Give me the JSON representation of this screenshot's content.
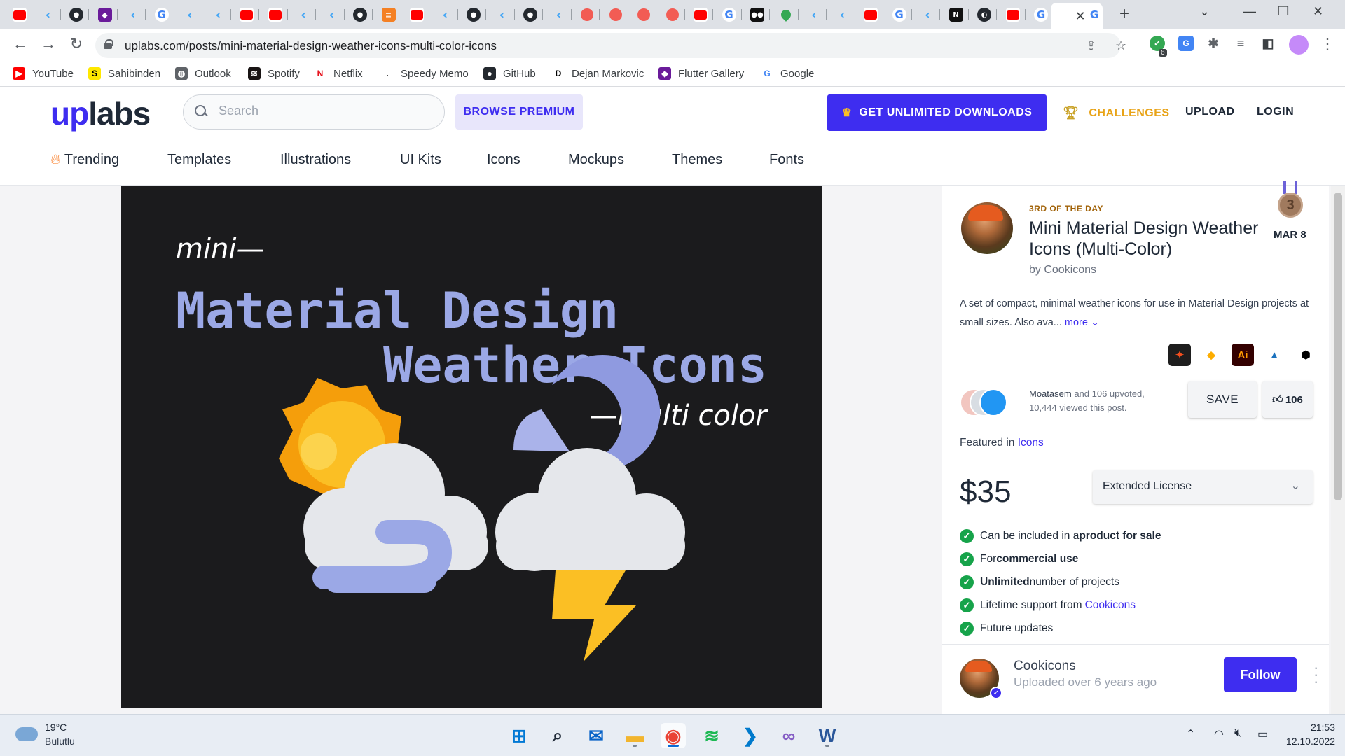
{
  "browser": {
    "tabs": [
      {
        "icon": "youtube-icon",
        "cls": "yt",
        "glyph": ""
      },
      {
        "icon": "flutter-icon",
        "cls": "flutter",
        "glyph": "‹"
      },
      {
        "icon": "github-icon",
        "cls": "gh",
        "glyph": "●"
      },
      {
        "icon": "visual-studio-icon",
        "cls": "purple",
        "glyph": "◆"
      },
      {
        "icon": "flutter-icon",
        "cls": "flutter",
        "glyph": "‹"
      },
      {
        "icon": "google-icon",
        "cls": "g",
        "glyph": "G"
      },
      {
        "icon": "flutter-icon",
        "cls": "flutter",
        "glyph": "‹"
      },
      {
        "icon": "flutter-icon",
        "cls": "flutter",
        "glyph": "‹"
      },
      {
        "icon": "youtube-icon",
        "cls": "yt",
        "glyph": ""
      },
      {
        "icon": "youtube-icon",
        "cls": "yt",
        "glyph": ""
      },
      {
        "icon": "flutter-icon",
        "cls": "flutter",
        "glyph": "‹"
      },
      {
        "icon": "flutter-icon",
        "cls": "flutter",
        "glyph": "‹"
      },
      {
        "icon": "github-icon",
        "cls": "gh",
        "glyph": "●"
      },
      {
        "icon": "stackoverflow-icon",
        "cls": "orange",
        "glyph": "≡"
      },
      {
        "icon": "youtube-icon",
        "cls": "yt",
        "glyph": ""
      },
      {
        "icon": "flutter-icon",
        "cls": "flutter",
        "glyph": "‹"
      },
      {
        "icon": "github-icon",
        "cls": "gh",
        "glyph": "●"
      },
      {
        "icon": "flutter-icon",
        "cls": "flutter",
        "glyph": "‹"
      },
      {
        "icon": "github-icon",
        "cls": "gh",
        "glyph": "●"
      },
      {
        "icon": "flutter-icon",
        "cls": "flutter",
        "glyph": "‹"
      },
      {
        "icon": "mushroom-icon",
        "cls": "red",
        "glyph": ""
      },
      {
        "icon": "mushroom-icon",
        "cls": "red",
        "glyph": ""
      },
      {
        "icon": "mushroom-icon",
        "cls": "red",
        "glyph": ""
      },
      {
        "icon": "mushroom-icon",
        "cls": "red",
        "glyph": ""
      },
      {
        "icon": "youtube-icon",
        "cls": "yt",
        "glyph": ""
      },
      {
        "icon": "google-icon",
        "cls": "g",
        "glyph": "G"
      },
      {
        "icon": "medium-icon",
        "cls": "dark",
        "glyph": "●●"
      },
      {
        "icon": "google-maps-icon",
        "cls": "maps",
        "glyph": ""
      },
      {
        "icon": "flutter-icon",
        "cls": "flutter",
        "glyph": "‹"
      },
      {
        "icon": "flutter-icon",
        "cls": "flutter",
        "glyph": "‹"
      },
      {
        "icon": "youtube-icon",
        "cls": "yt",
        "glyph": ""
      },
      {
        "icon": "google-icon",
        "cls": "g",
        "glyph": "G"
      },
      {
        "icon": "flutter-icon",
        "cls": "flutter",
        "glyph": "‹"
      },
      {
        "icon": "notion-icon",
        "cls": "dark",
        "glyph": "N"
      },
      {
        "icon": "cloud-app-icon",
        "cls": "gh",
        "glyph": "◐"
      },
      {
        "icon": "youtube-icon",
        "cls": "yt",
        "glyph": ""
      },
      {
        "icon": "google-icon",
        "cls": "g",
        "glyph": "G"
      }
    ],
    "active_tab_close": "✕",
    "after_tab": {
      "icon": "google-icon",
      "glyph": "G"
    },
    "new_tab": "+",
    "url": "uplabs.com/posts/mini-material-design-weather-icons-multi-color-icons",
    "extension_badge": "6",
    "bookmarks": [
      {
        "label": "YouTube",
        "icon": "youtube-icon",
        "color": "#ff0000",
        "glyph": "▶"
      },
      {
        "label": "Sahibinden",
        "icon": "sahibinden-icon",
        "color": "#ffe800",
        "glyph": "S"
      },
      {
        "label": "Outlook",
        "icon": "globe-icon",
        "color": "#5f6368",
        "glyph": "◍"
      },
      {
        "label": "Spotify",
        "icon": "spotify-icon",
        "color": "#191414",
        "glyph": "≋"
      },
      {
        "label": "Netflix",
        "icon": "netflix-icon",
        "color": "#ffffff",
        "glyph": "N"
      },
      {
        "label": "Speedy Memo",
        "icon": "memo-icon",
        "color": "#ffffff",
        "glyph": "."
      },
      {
        "label": "GitHub",
        "icon": "github-icon",
        "color": "#24292f",
        "glyph": "●"
      },
      {
        "label": "Dejan Markovic",
        "icon": "d-icon",
        "color": "#ffffff",
        "glyph": "D"
      },
      {
        "label": "Flutter Gallery",
        "icon": "flutter-gallery-icon",
        "color": "#6a1b9a",
        "glyph": "◆"
      },
      {
        "label": "Google",
        "icon": "google-icon",
        "color": "#ffffff",
        "glyph": "G"
      }
    ]
  },
  "header": {
    "logo_up": "up",
    "logo_labs": "labs",
    "search_placeholder": "Search",
    "browse_premium": "BROWSE PREMIUM",
    "unlimited_downloads": "GET UNLIMITED DOWNLOADS",
    "challenges": "CHALLENGES",
    "upload": "UPLOAD",
    "login": "LOGIN"
  },
  "nav": [
    "Trending",
    "Templates",
    "Illustrations",
    "UI Kits",
    "Icons",
    "Mockups",
    "Themes",
    "Fonts"
  ],
  "hero": {
    "mini": "mini—",
    "title_line1": "Material Design",
    "title_line2": "Weather Icons",
    "multi": "—multi color"
  },
  "post": {
    "rank_label": "3RD OF THE DAY",
    "medal_number": "3",
    "date": "MAR 8",
    "title": "Mini Material Design Weather Icons (Multi-Color)",
    "byline": "by Cookicons",
    "description": "A set of compact, minimal weather icons for use in Material Design projects at small sizes. Also ava...",
    "more": "more",
    "tools": [
      {
        "icon": "figma-icon",
        "bg": "#1e1e1e",
        "fg": "#f24e1e",
        "glyph": "✦"
      },
      {
        "icon": "sketch-icon",
        "bg": "#ffffff",
        "fg": "#fdad00",
        "glyph": "◆"
      },
      {
        "icon": "illustrator-icon",
        "bg": "#330000",
        "fg": "#ff9a00",
        "glyph": "Ai"
      },
      {
        "icon": "affinity-designer-icon",
        "bg": "#ffffff",
        "fg": "#1b72be",
        "glyph": "▲"
      },
      {
        "icon": "inkscape-icon",
        "bg": "#ffffff",
        "fg": "#000000",
        "glyph": "⬢"
      }
    ],
    "upvoter_name": "Moatasem",
    "upvote_rest": " and 106 upvoted,",
    "views": "10,444 viewed this post.",
    "save": "SAVE",
    "likes": "106",
    "featured_prefix": "Featured in ",
    "featured_link": "Icons",
    "price": "$35",
    "license": "Extended License",
    "features": [
      {
        "pre": "Can be included in a ",
        "bold": "product for sale",
        "post": "",
        "link": ""
      },
      {
        "pre": "For ",
        "bold": "commercial use",
        "post": "",
        "link": ""
      },
      {
        "pre": "",
        "bold": "Unlimited",
        "post": " number of projects",
        "link": ""
      },
      {
        "pre": "Lifetime support from",
        "bold": "",
        "post": "",
        "link": "Cookicons"
      },
      {
        "pre": "Future updates",
        "bold": "",
        "post": "",
        "link": ""
      }
    ],
    "author_name": "Cookicons",
    "author_sub": "Uploaded over 6 years ago",
    "follow": "Follow"
  },
  "taskbar": {
    "temp": "19°C",
    "weather": "Bulutlu",
    "apps": [
      {
        "icon": "windows-start-icon",
        "color": "#0078d4",
        "glyph": "⊞",
        "active": false,
        "dot": false
      },
      {
        "icon": "search-icon",
        "color": "#1f2937",
        "glyph": "⌕",
        "active": false,
        "dot": false
      },
      {
        "icon": "mail-icon",
        "color": "#0a64c8",
        "glyph": "✉",
        "active": false,
        "dot": false
      },
      {
        "icon": "file-explorer-icon",
        "color": "#f2b52e",
        "glyph": "▬",
        "active": false,
        "dot": true
      },
      {
        "icon": "chrome-icon",
        "color": "#ea4335",
        "glyph": "◉",
        "active": true,
        "dot": true
      },
      {
        "icon": "spotify-icon",
        "color": "#1db954",
        "glyph": "≋",
        "active": false,
        "dot": false
      },
      {
        "icon": "vscode-icon",
        "color": "#007acc",
        "glyph": "❯",
        "active": false,
        "dot": false
      },
      {
        "icon": "visual-studio-icon",
        "color": "#865fc5",
        "glyph": "∞",
        "active": false,
        "dot": false
      },
      {
        "icon": "word-icon",
        "color": "#2b579a",
        "glyph": "W",
        "active": false,
        "dot": true
      }
    ],
    "time": "21:53",
    "date": "12.10.2022"
  }
}
